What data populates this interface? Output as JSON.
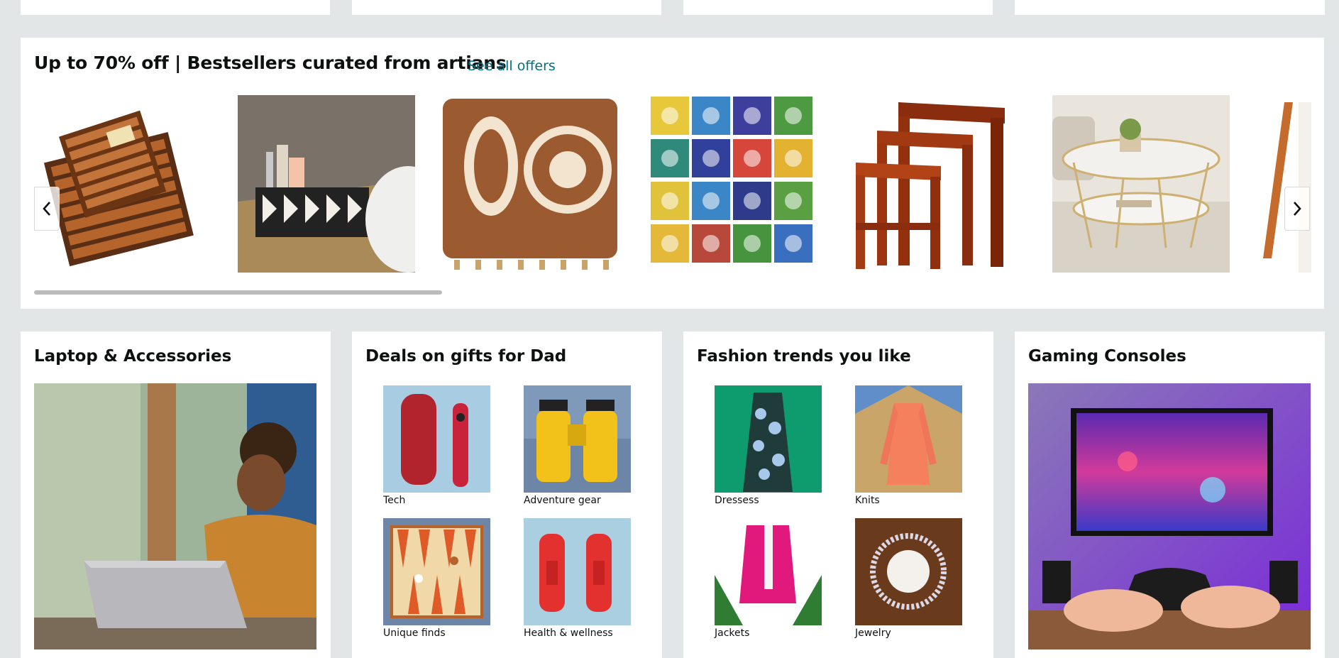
{
  "carousel": {
    "title": "Up to 70% off | Bestsellers curated from artians",
    "see_all": "See all offers",
    "items": [
      {
        "icon": "wooden-trays-image"
      },
      {
        "icon": "woven-basket-image"
      },
      {
        "icon": "ganesha-key-holder-image"
      },
      {
        "icon": "ceramic-tiles-image"
      },
      {
        "icon": "nesting-tables-image"
      },
      {
        "icon": "coffee-table-image"
      },
      {
        "icon": "wooden-frame-image"
      }
    ],
    "prev_icon": "chevron-left-icon",
    "next_icon": "chevron-right-icon",
    "scroll_fraction": 0.32
  },
  "cards": {
    "laptop": {
      "title": "Laptop & Accessories",
      "image": "woman-with-laptop-image"
    },
    "dad": {
      "title": "Deals on gifts for Dad",
      "items": [
        {
          "label": "Tech",
          "image": "speaker-remote-image"
        },
        {
          "label": "Adventure gear",
          "image": "binoculars-image"
        },
        {
          "label": "Unique finds",
          "image": "backgammon-image"
        },
        {
          "label": "Health & wellness",
          "image": "dumbbells-image"
        }
      ]
    },
    "fashion": {
      "title": "Fashion trends you like",
      "items": [
        {
          "label": "Dressess",
          "image": "dress-image"
        },
        {
          "label": "Knits",
          "image": "knit-cardigan-image"
        },
        {
          "label": "Jackets",
          "image": "pink-jacket-image"
        },
        {
          "label": "Jewelry",
          "image": "necklace-image"
        }
      ]
    },
    "gaming": {
      "title": "Gaming Consoles",
      "image": "gaming-console-image"
    }
  },
  "colors": {
    "background": "#e3e6e6",
    "link": "#007185",
    "card": "#ffffff"
  }
}
